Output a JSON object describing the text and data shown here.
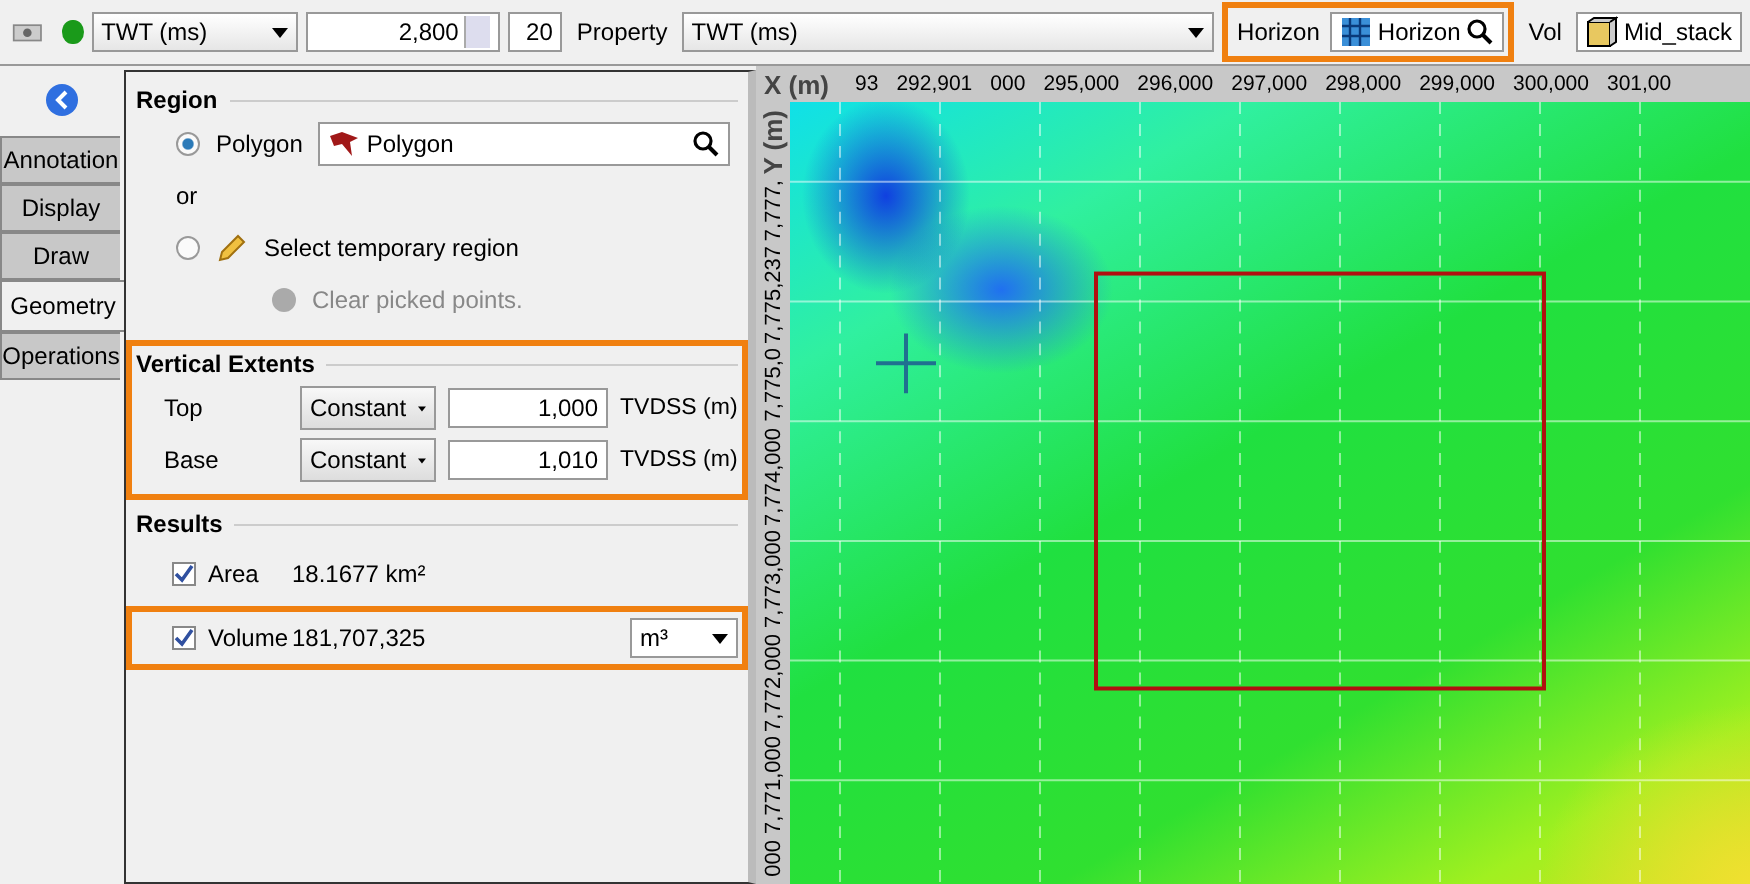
{
  "toolbar": {
    "status_on": true,
    "domain": "TWT (ms)",
    "value": "2,800",
    "step": "20",
    "property_label": "Property",
    "property": "TWT (ms)",
    "horizon_label": "Horizon",
    "horizon": "Horizon",
    "horizon_highlighted": true,
    "vol_label": "Vol",
    "vol": "Mid_stack"
  },
  "tabs": [
    {
      "label": "Annotation",
      "selected": false
    },
    {
      "label": "Display",
      "selected": false
    },
    {
      "label": "Draw",
      "selected": false
    },
    {
      "label": "Geometry",
      "selected": true
    },
    {
      "label": "Operations",
      "selected": false
    }
  ],
  "region": {
    "title": "Region",
    "polygon_label": "Polygon",
    "polygon_selected": true,
    "polygon_value": "Polygon",
    "or": "or",
    "temp_label": "Select temporary region",
    "temp_selected": false,
    "clear_label": "Clear picked points."
  },
  "vertical_extents": {
    "title": "Vertical Extents",
    "highlighted": true,
    "rows": [
      {
        "label": "Top",
        "mode": "Constant",
        "value": "1,000",
        "unit": "TVDSS (m)"
      },
      {
        "label": "Base",
        "mode": "Constant",
        "value": "1,010",
        "unit": "TVDSS (m)"
      }
    ]
  },
  "results": {
    "title": "Results",
    "rows": [
      {
        "label": "Area",
        "checked": true,
        "value": "18.1677 km²",
        "highlighted": false
      },
      {
        "label": "Volume",
        "checked": true,
        "value": "181,707,325",
        "unit": "m³",
        "highlighted": true
      }
    ]
  },
  "map": {
    "x_axis_label": "X (m)",
    "x_labels": [
      "93",
      "292,901",
      "000",
      "295,000",
      "296,000",
      "297,000",
      "298,000",
      "299,000",
      "300,000",
      "301,00"
    ],
    "y_axis_label": "Y (m)",
    "y_labels": [
      "7,777,",
      "7,775,237",
      "7,775,0",
      "7,774,000",
      "7,773,000",
      "7,772,000",
      "7,771,000",
      "000"
    ]
  }
}
